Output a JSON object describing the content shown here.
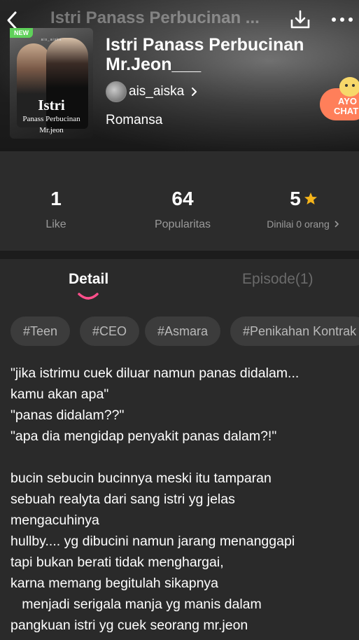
{
  "header": {
    "ghost_title": "Istri Panass Perbucinan ...",
    "back_icon": "chevron-left-icon",
    "download_icon": "download-icon",
    "more_icon": "more-dots-icon"
  },
  "book": {
    "new_badge": "NEW",
    "cover_text": {
      "top": "ais_aiska",
      "line1": "Istri",
      "line2": "Panass Perbucinan",
      "line3": "Mr.jeon"
    },
    "title": "Istri Panass Perbucinan Mr.Jeon___",
    "author": "ais_aiska",
    "genre": "Romansa"
  },
  "chat_bubble": {
    "line1": "AYO",
    "line2": "CHAT"
  },
  "stats": {
    "likes": {
      "value": "1",
      "label": "Like"
    },
    "popularity": {
      "value": "64",
      "label": "Popularitas"
    },
    "rating": {
      "value": "5",
      "label": "Dinilai 0 orang",
      "star_color": "#f5b41a"
    }
  },
  "tabs": {
    "detail": "Detail",
    "episode": "Episode(1)",
    "indicator_color": "#ff4f8b"
  },
  "tags": [
    "#Teen",
    "#CEO",
    "#Asmara",
    "#Penikahan Kontrak"
  ],
  "description": "\"jika istrimu cuek diluar namun panas didalam...\nkamu akan apa\"\n\"panas didalam??\"\n\"apa dia mengidap penyakit panas dalam?!\"\n\nbucin sebucin bucinnya meski itu tamparan\nsebuah realyta dari sang istri yg jelas\nmengacuhinya\nhullby.... yg dibucini namun jarang menanggapi\ntapi bukan berati tidak menghargai,\nkarna memang begitulah sikapnya\n   menjadi serigala manja yg manis dalam\npangkuan istri yg cuek seorang mr.jeon"
}
